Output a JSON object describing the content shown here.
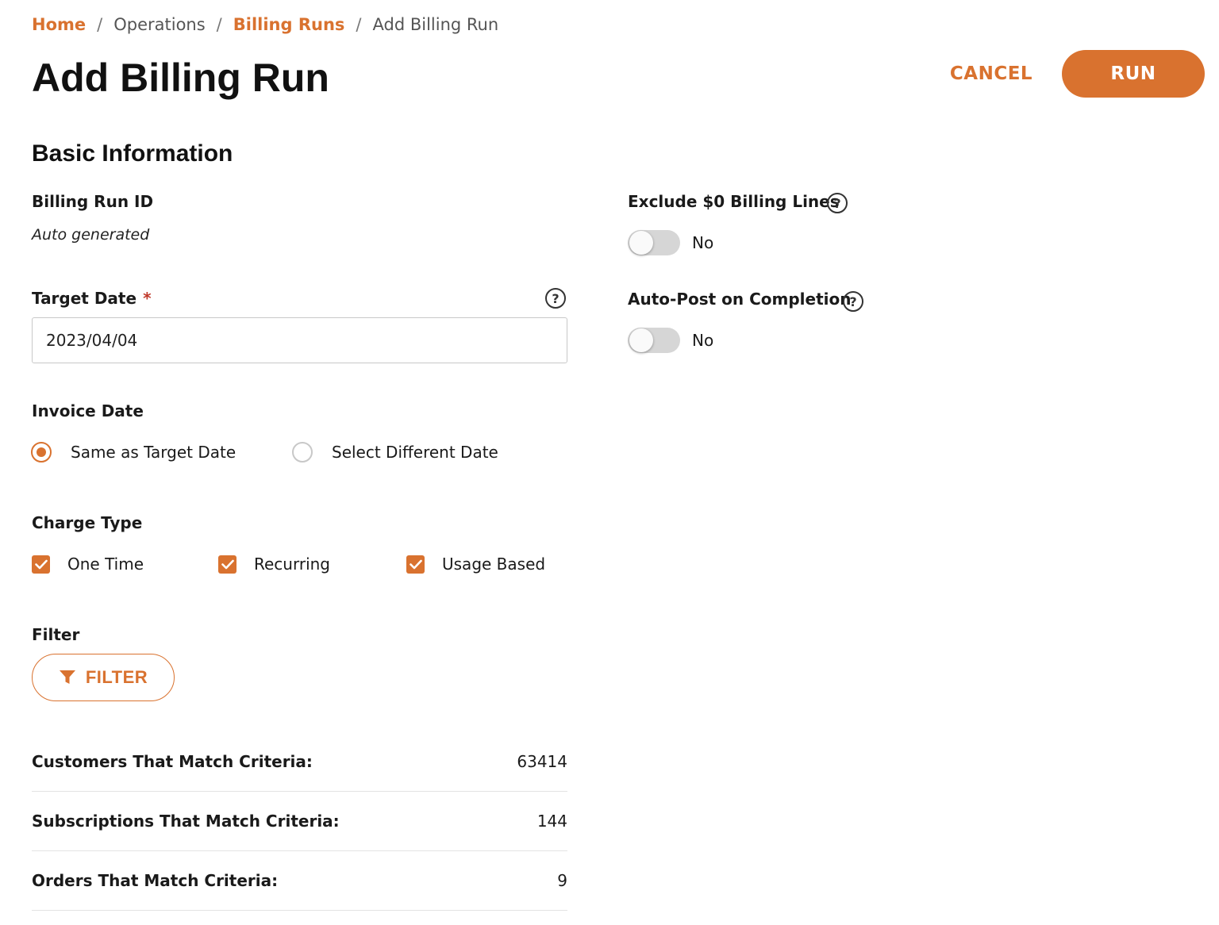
{
  "breadcrumb": {
    "home": "Home",
    "operations": "Operations",
    "billing_runs": "Billing Runs",
    "current": "Add Billing Run",
    "separator": "/"
  },
  "header": {
    "title": "Add Billing Run",
    "cancel_label": "CANCEL",
    "run_label": "RUN"
  },
  "section": {
    "title": "Basic Information"
  },
  "billing_run_id": {
    "label": "Billing Run ID",
    "value": "Auto generated"
  },
  "target_date": {
    "label": "Target Date",
    "required_mark": "*",
    "value": "2023/04/04",
    "help_icon": "question-circle-icon"
  },
  "invoice_date": {
    "label": "Invoice Date",
    "options": [
      {
        "label": "Same as Target Date",
        "selected": true
      },
      {
        "label": "Select Different Date",
        "selected": false
      }
    ]
  },
  "charge_type": {
    "label": "Charge Type",
    "options": [
      {
        "label": "One Time",
        "checked": true
      },
      {
        "label": "Recurring",
        "checked": true
      },
      {
        "label": "Usage Based",
        "checked": true
      }
    ]
  },
  "filter": {
    "label": "Filter",
    "button_label": "FILTER",
    "icon": "funnel-icon"
  },
  "criteria": [
    {
      "label": "Customers That Match Criteria:",
      "value": "63414"
    },
    {
      "label": "Subscriptions That Match Criteria:",
      "value": "144"
    },
    {
      "label": "Orders That Match Criteria:",
      "value": "9"
    }
  ],
  "exclude_zero": {
    "label": "Exclude $0 Billing Lines",
    "state_label": "No",
    "enabled": false
  },
  "auto_post": {
    "label": "Auto-Post on Completion",
    "state_label": "No",
    "enabled": false
  },
  "colors": {
    "accent": "#d9722f",
    "required": "#c0392b",
    "toggle_off": "#d6d6d6"
  }
}
